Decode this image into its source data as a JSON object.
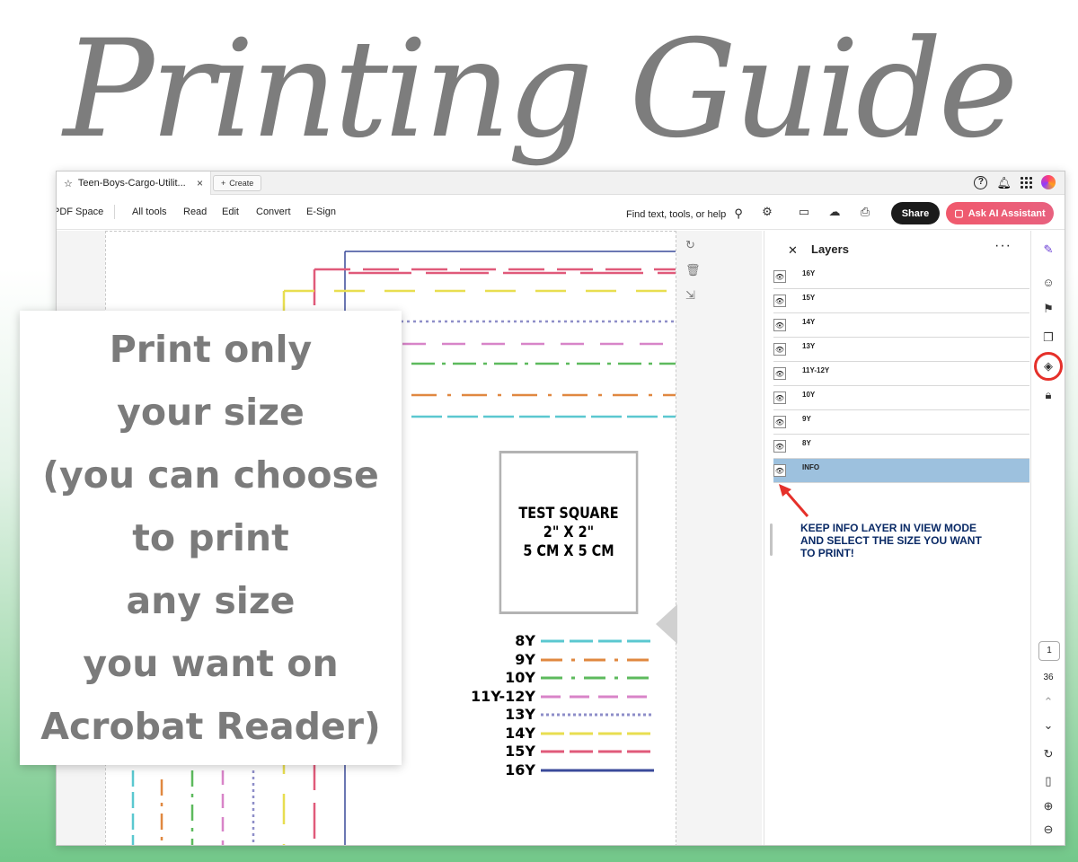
{
  "hero": {
    "title": "Printing Guide"
  },
  "app": {
    "tab": {
      "title": "Teen-Boys-Cargo-Utilit...",
      "close": "×"
    },
    "create_label": "Create",
    "toolbar": {
      "pdf_space": "PDF Space",
      "menu": [
        "All tools",
        "Read",
        "Edit",
        "Convert",
        "E-Sign"
      ],
      "search_text": "Find text, tools, or help",
      "share_label": "Share",
      "ai_label": "Ask AI Assistant"
    },
    "test_square": {
      "line1": "TEST SQUARE",
      "line2": "2\" X 2\"",
      "line3": "5 CM X 5 CM"
    },
    "legend": [
      {
        "label": "8Y",
        "color": "#5bc8d0",
        "style": "long-dash"
      },
      {
        "label": "9Y",
        "color": "#e08840",
        "style": "dash-dot"
      },
      {
        "label": "10Y",
        "color": "#5dba5d",
        "style": "dash-dot"
      },
      {
        "label": "11Y-12Y",
        "color": "#d884c8",
        "style": "dash"
      },
      {
        "label": "13Y",
        "color": "#8e8ec8",
        "style": "dotted"
      },
      {
        "label": "14Y",
        "color": "#e8de50",
        "style": "long-dash"
      },
      {
        "label": "15Y",
        "color": "#e05a7a",
        "style": "long-dash"
      },
      {
        "label": "16Y",
        "color": "#3a4a9a",
        "style": "solid"
      }
    ],
    "layers": {
      "title": "Layers",
      "items": [
        {
          "name": "16Y",
          "selected": false
        },
        {
          "name": "15Y",
          "selected": false
        },
        {
          "name": "14Y",
          "selected": false
        },
        {
          "name": "13Y",
          "selected": false
        },
        {
          "name": "11Y-12Y",
          "selected": false
        },
        {
          "name": "10Y",
          "selected": false
        },
        {
          "name": "9Y",
          "selected": false
        },
        {
          "name": "8Y",
          "selected": false
        },
        {
          "name": "INFO",
          "selected": true
        }
      ],
      "note": [
        "KEEP INFO LAYER IN VIEW MODE",
        "AND SELECT THE SIZE YOU WANT",
        "TO PRINT!"
      ]
    },
    "pagination": {
      "current": "1",
      "total": "36"
    }
  },
  "overlay": {
    "lines": [
      "Print only",
      "your size",
      "(you can choose",
      "to print",
      "any size",
      "you want on",
      "Acrobat Reader)"
    ]
  },
  "colors": {
    "accent_red": "#e5302a",
    "selected_row": "#9dc1de",
    "ai_button": "#f0596c"
  }
}
